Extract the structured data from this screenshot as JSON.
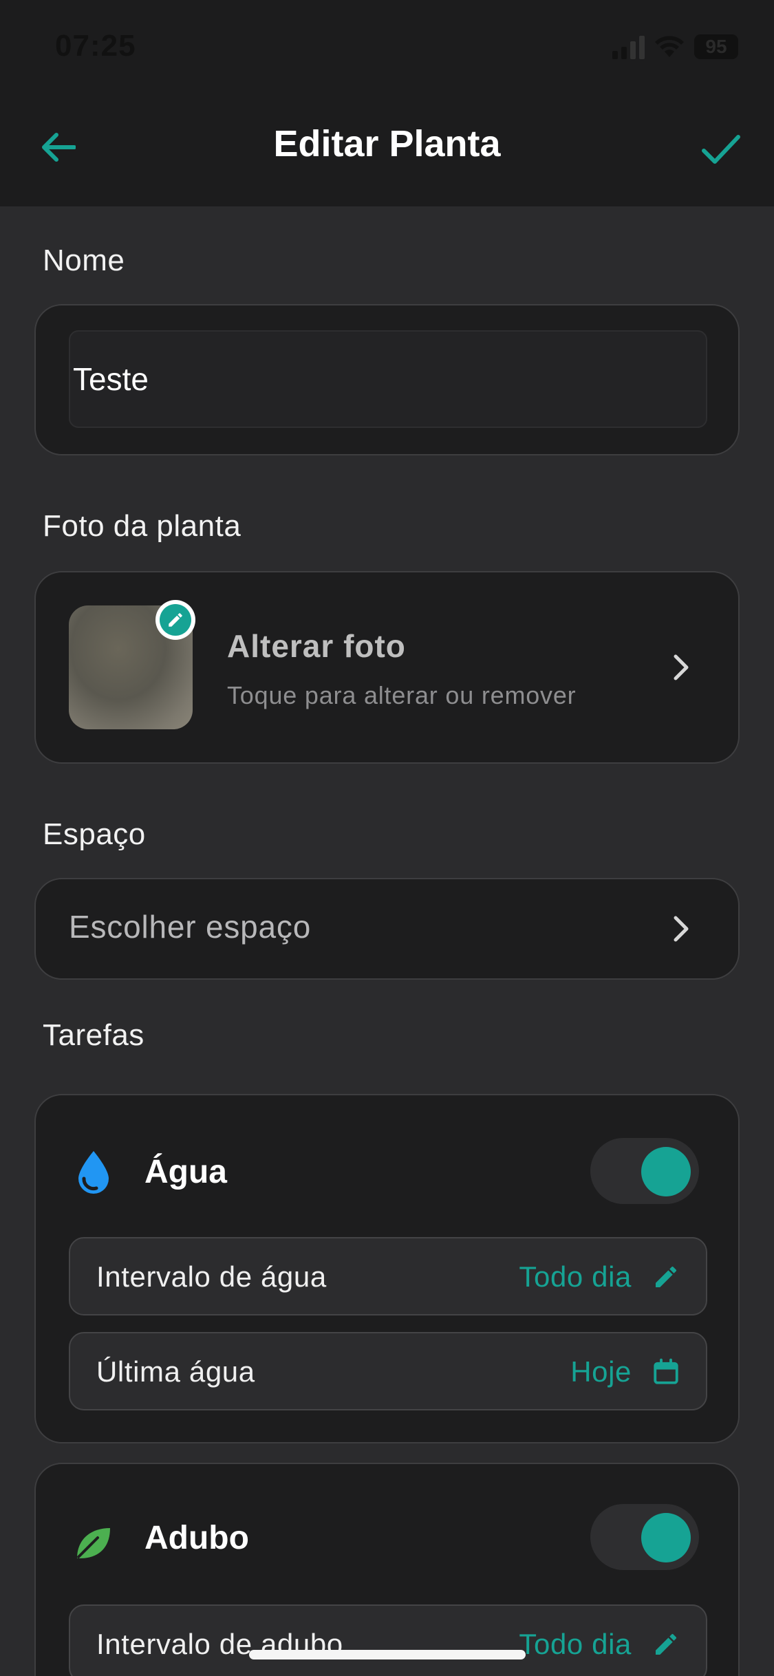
{
  "status_bar": {
    "time": "07:25",
    "battery": "95"
  },
  "header": {
    "title": "Editar Planta"
  },
  "name_section": {
    "label": "Nome",
    "value": "Teste"
  },
  "photo_section": {
    "label": "Foto da planta",
    "title": "Alterar foto",
    "subtitle": "Toque para alterar ou remover"
  },
  "space_section": {
    "label": "Espaço",
    "placeholder": "Escolher espaço"
  },
  "tasks_section": {
    "label": "Tarefas",
    "water": {
      "name": "Água",
      "enabled": true,
      "interval_label": "Intervalo de água",
      "interval_value": "Todo dia",
      "last_label": "Última água",
      "last_value": "Hoje"
    },
    "fertilizer": {
      "name": "Adubo",
      "enabled": true,
      "interval_label": "Intervalo de adubo",
      "interval_value": "Todo dia"
    }
  },
  "colors": {
    "accent": "#16a394",
    "water_icon": "#2196f3",
    "leaf_icon": "#4caf50",
    "background": "#2b2b2d",
    "card": "#1d1d1e"
  }
}
